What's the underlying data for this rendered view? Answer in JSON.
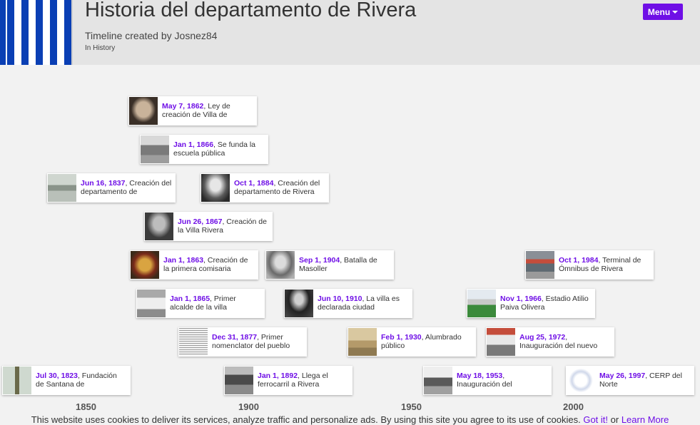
{
  "header": {
    "title": "Historia del departamento de Rivera",
    "subtitle": "Timeline created by Josnez84",
    "category": "In History",
    "menu_label": "Menu"
  },
  "events": [
    {
      "date": "May 7, 1862",
      "text": ", Ley de creación de Villa de",
      "thumb": "portrait-photo"
    },
    {
      "date": "Jan 1, 1866",
      "text": ", Se funda la escuela pública",
      "thumb": "building-photo"
    },
    {
      "date": "Jun 16, 1837",
      "text": ", Creación del departamento de",
      "thumb": "landscape-photo"
    },
    {
      "date": "Oct 1, 1884",
      "text": ", Creación del departamento de Rivera",
      "thumb": "portrait-photo"
    },
    {
      "date": "Jun 26, 1867",
      "text": ", Creación de la Villa Rivera",
      "thumb": "portrait-photo"
    },
    {
      "date": "Jan 1, 1863",
      "text": ", Creación de la primera comisaria",
      "thumb": "emblem-photo"
    },
    {
      "date": "Sep 1, 1904",
      "text": ", Batalla de Masoller",
      "thumb": "portrait-photo"
    },
    {
      "date": "Oct 1, 1984",
      "text": ", Terminal de Ómnibus de Rivera",
      "thumb": "street-photo"
    },
    {
      "date": "Jan 1, 1865",
      "text": ", Primer alcalde de la villa",
      "thumb": "building-photo"
    },
    {
      "date": "Jun 10, 1910",
      "text": ", La villa es declarada ciudad",
      "thumb": "portrait-photo"
    },
    {
      "date": "Nov 1, 1966",
      "text": ", Estadio Atilio Paiva Olivera",
      "thumb": "stadium-photo"
    },
    {
      "date": "Dec 31, 1877",
      "text": ", Primer nomenclator del pueblo",
      "thumb": "document-photo"
    },
    {
      "date": "Feb 1, 1930",
      "text": ", Alumbrado público",
      "thumb": "street-photo"
    },
    {
      "date": "Aug 25, 1972",
      "text": ", Inauguración del nuevo",
      "thumb": "building-photo"
    },
    {
      "date": "Jul 30, 1823",
      "text": ", Fundación de Santana de",
      "thumb": "monument-photo"
    },
    {
      "date": "Jan 1, 1892",
      "text": ", Llega el ferrocarril a Rivera",
      "thumb": "train-photo"
    },
    {
      "date": "May 18, 1953",
      "text": ", Inauguración del",
      "thumb": "building-photo"
    },
    {
      "date": "May 26, 1997",
      "text": ", CERP del Norte",
      "thumb": "logo-photo"
    }
  ],
  "axis": {
    "labels": [
      "1850",
      "1900",
      "1950",
      "2000"
    ]
  },
  "cookie": {
    "text": "This website uses cookies to deliver its services, analyze traffic and personalize ads. By using this site you agree to its use of cookies.",
    "got_it": "Got it!",
    "or": " or ",
    "learn_more": "Learn More"
  },
  "colors": {
    "accent": "#6f0fe6",
    "header_bg": "#e4e4e4",
    "page_bg": "#f2f2f2"
  }
}
